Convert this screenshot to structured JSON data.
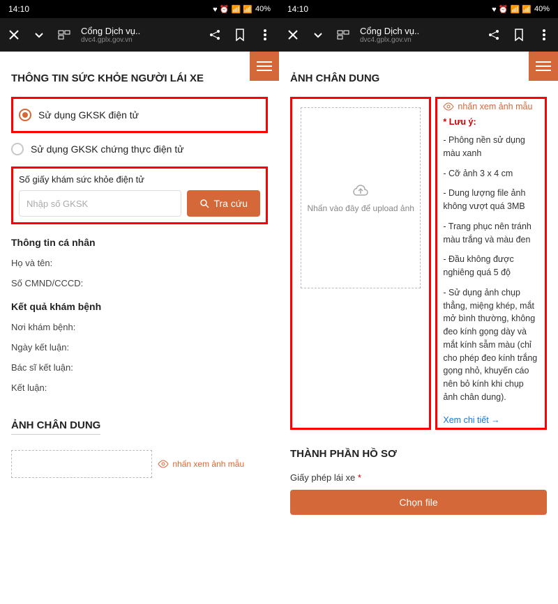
{
  "status": {
    "time": "14:10",
    "battery": "40%"
  },
  "browser": {
    "title": "Cổng Dịch vụ..",
    "url": "dvc4.gplx.gov.vn"
  },
  "left": {
    "section_title": "THÔNG TIN SỨC KHỎE NGƯỜI LÁI XE",
    "radio1": "Sử dụng GKSK điện tử",
    "radio2": "Sử dụng GKSK chứng thực điện tử",
    "lookup_label": "Số giấy khám sức khỏe điện tử",
    "lookup_placeholder": "Nhập số GKSK",
    "lookup_btn": "Tra cứu",
    "personal_title": "Thông tin cá nhân",
    "fullname": "Họ và tên:",
    "idnum": "Số CMND/CCCD:",
    "exam_title": "Kết quả khám bệnh",
    "exam_place": "Nơi khám bệnh:",
    "exam_date": "Ngày kết luận:",
    "exam_doctor": "Bác sĩ kết luận:",
    "exam_result": "Kết luận:",
    "portrait_title": "ẢNH CHÂN DUNG",
    "sample_link": "nhấn xem ảnh mẫu"
  },
  "right": {
    "section_title": "ẢNH CHÂN DUNG",
    "upload_text": "Nhấn vào đây để upload ảnh",
    "sample_link": "nhấn xem ảnh mẫu",
    "warn_title": "* Lưu ý:",
    "n1": "- Phông nền sử dụng màu xanh",
    "n2": "- Cỡ ảnh 3 x 4 cm",
    "n3": "- Dung lượng file ảnh không vượt quá 3MB",
    "n4": "- Trang phục nên tránh màu trắng và màu đen",
    "n5": "- Đầu không được nghiêng quá 5 độ",
    "n6": "- Sử dụng ảnh chụp thẳng, miệng khép, mắt mở bình thường, không đeo kính gọng dày và mắt kính sẫm màu (chỉ cho phép đeo kính trắng gọng nhỏ, khuyến cáo nên bỏ kính khi chụp ảnh chân dung).",
    "detail_link": "Xem chi tiết →",
    "docs_title": "THÀNH PHẦN HỒ SƠ",
    "doc1": "Giấy phép lái xe",
    "choose_btn": "Chọn file"
  }
}
